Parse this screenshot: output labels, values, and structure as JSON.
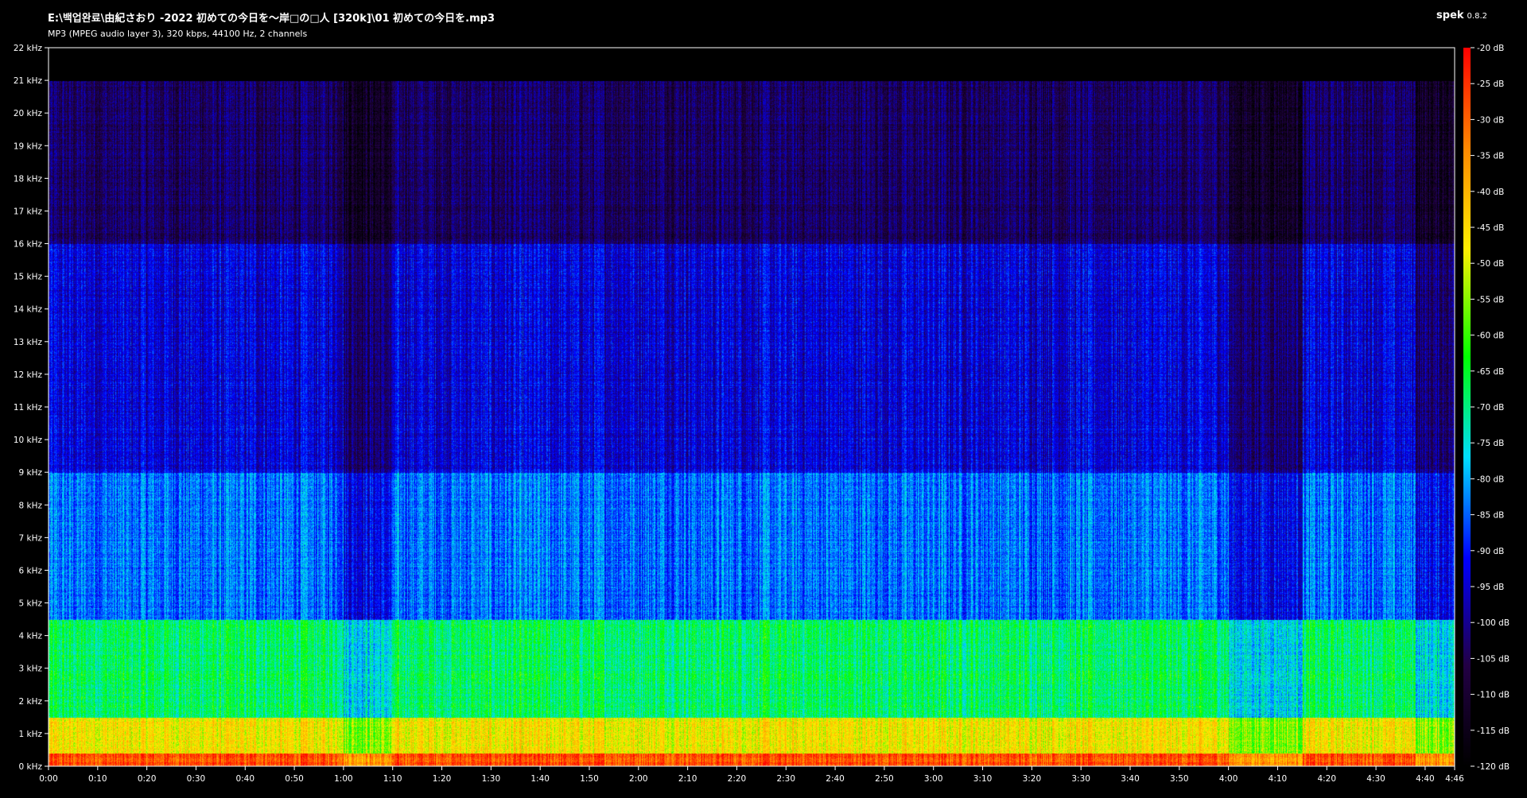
{
  "window": {
    "title": "E:\\백업완료\\由紀さおり -2022 初めての今日を～岸□の□人 [320k]\\01 初めての今日を.mp3",
    "subtitle": "MP3 (MPEG audio layer 3), 320 kbps, 44100 Hz, 2 channels",
    "app_name": "spek",
    "app_version": "0.8.2"
  },
  "chart_data": {
    "type": "heatmap",
    "title": "E:\\백업완료\\由紀さおり -2022 初めての今日を～岸□の□人 [320k]\\01 初めての今日を.mp3",
    "subtitle": "MP3 (MPEG audio layer 3), 320 kbps, 44100 Hz, 2 channels",
    "x_unit": "time (min:sec)",
    "x_range_seconds": [
      0,
      286
    ],
    "x_tick_labels": [
      "0:00",
      "0:10",
      "0:20",
      "0:30",
      "0:40",
      "0:50",
      "1:00",
      "1:10",
      "1:20",
      "1:30",
      "1:40",
      "1:50",
      "2:00",
      "2:10",
      "2:20",
      "2:30",
      "2:40",
      "2:50",
      "3:00",
      "3:10",
      "3:20",
      "3:30",
      "3:40",
      "3:50",
      "4:00",
      "4:10",
      "4:20",
      "4:30",
      "4:40",
      "4:46"
    ],
    "x_tick_values": [
      0,
      10,
      20,
      30,
      40,
      50,
      60,
      70,
      80,
      90,
      100,
      110,
      120,
      130,
      140,
      150,
      160,
      170,
      180,
      190,
      200,
      210,
      220,
      230,
      240,
      250,
      260,
      270,
      280,
      286
    ],
    "y_unit": "kHz",
    "y_range": [
      0,
      22
    ],
    "y_tick_labels": [
      "0 kHz",
      "1 kHz",
      "2 kHz",
      "3 kHz",
      "4 kHz",
      "5 kHz",
      "6 kHz",
      "7 kHz",
      "8 kHz",
      "9 kHz",
      "10 kHz",
      "11 kHz",
      "12 kHz",
      "13 kHz",
      "14 kHz",
      "15 kHz",
      "16 kHz",
      "17 kHz",
      "18 kHz",
      "19 kHz",
      "20 kHz",
      "21 kHz",
      "22 kHz"
    ],
    "colorbar": {
      "unit": "dB",
      "range": [
        -120,
        -20
      ],
      "tick_labels": [
        "-20 dB",
        "-25 dB",
        "-30 dB",
        "-35 dB",
        "-40 dB",
        "-45 dB",
        "-50 dB",
        "-55 dB",
        "-60 dB",
        "-65 dB",
        "-70 dB",
        "-75 dB",
        "-80 dB",
        "-85 dB",
        "-90 dB",
        "-95 dB",
        "-100 dB",
        "-105 dB",
        "-110 dB",
        "-115 dB",
        "-120 dB"
      ],
      "colors_top_to_bottom": [
        "#ff0000",
        "#ff8800",
        "#ffee00",
        "#00ff00",
        "#00ddff",
        "#0000ff",
        "#220044",
        "#000000"
      ]
    },
    "spectral_cutoff_khz": 21,
    "heatmap_bands_db": [
      {
        "khz_from": 0,
        "khz_to": 0.4,
        "db": -28
      },
      {
        "khz_from": 0.4,
        "khz_to": 1.5,
        "db": -48
      },
      {
        "khz_from": 1.5,
        "khz_to": 4.5,
        "db": -68
      },
      {
        "khz_from": 4.5,
        "khz_to": 9,
        "db": -84
      },
      {
        "khz_from": 9,
        "khz_to": 16,
        "db": -94
      },
      {
        "khz_from": 16,
        "khz_to": 21,
        "db": -104
      }
    ],
    "grid": false
  }
}
